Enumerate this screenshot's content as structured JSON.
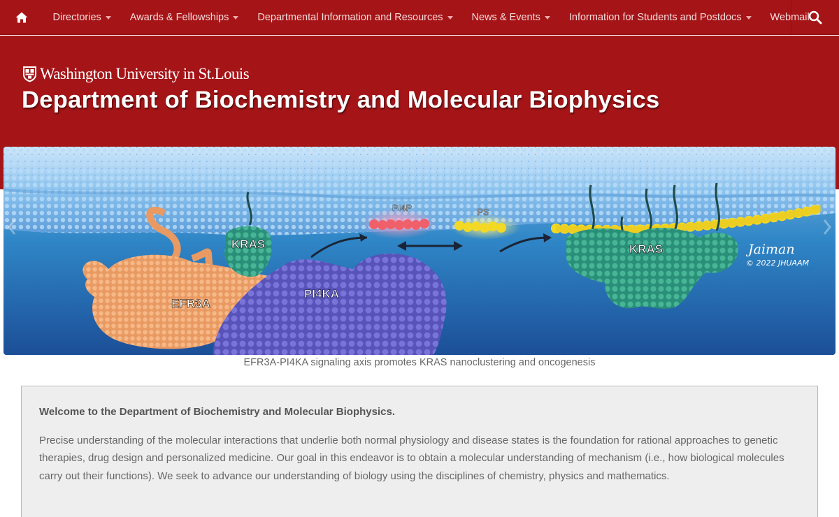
{
  "nav": {
    "home_icon": "home-icon",
    "items": [
      {
        "label": "Directories",
        "has_dropdown": true
      },
      {
        "label": "Awards & Fellowships",
        "has_dropdown": true
      },
      {
        "label": "Departmental Information and Resources",
        "has_dropdown": true
      },
      {
        "label": "News & Events",
        "has_dropdown": true
      },
      {
        "label": "Information for Students and Postdocs",
        "has_dropdown": true
      },
      {
        "label": "Webmail",
        "has_dropdown": false
      }
    ],
    "search_icon": "search-icon"
  },
  "masthead": {
    "university": "Washington University in St.Louis",
    "title": "Department of Biochemistry and Molecular Biophysics"
  },
  "hero": {
    "labels": {
      "kras_left": "KRAS",
      "efr3a": "EFR3A",
      "pi4ka": "PI4KA",
      "pi4p": "PI4P",
      "ps": "PS",
      "kras_right": "KRAS"
    },
    "signature": "Jaiman",
    "copyright": "© 2022 JHUAAM",
    "caption": "EFR3A-PI4KA signaling axis promotes KRAS nanoclustering and oncogenesis"
  },
  "welcome": {
    "title": "Welcome to the Department of Biochemistry and Molecular Biophysics.",
    "body": "Precise understanding of the molecular interactions that underlie both normal physiology and disease states is the foundation for rational approaches to genetic therapies, drug design and personalized medicine. Our goal in this endeavor is to obtain a molecular understanding of mechanism (i.e., how biological molecules carry out their functions). We seek to advance our understanding of biology using the disciplines of chemistry, physics and mathematics."
  },
  "colors": {
    "brand_red": "#a51417",
    "nav_text": "#f6dcdc",
    "box_bg": "#eeeeee"
  }
}
